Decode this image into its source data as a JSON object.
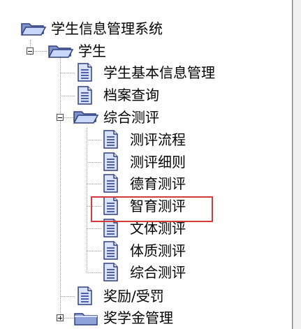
{
  "tree": {
    "root": {
      "label": "学生信息管理系统",
      "icon": "folder-open-icon"
    },
    "student": {
      "label": "学生",
      "icon": "folder-open-icon",
      "children": [
        {
          "label": "学生基本信息管理",
          "icon": "document-icon"
        },
        {
          "label": "档案查询",
          "icon": "document-icon"
        },
        {
          "label": "综合测评",
          "icon": "folder-open-icon",
          "children": [
            {
              "label": "测评流程",
              "icon": "document-icon"
            },
            {
              "label": "测评细则",
              "icon": "document-icon"
            },
            {
              "label": "德育测评",
              "icon": "document-icon"
            },
            {
              "label": "智育测评",
              "icon": "document-icon"
            },
            {
              "label": "文体测评",
              "icon": "document-icon"
            },
            {
              "label": "体质测评",
              "icon": "document-icon"
            },
            {
              "label": "综合测评",
              "icon": "document-icon"
            }
          ]
        },
        {
          "label": "奖励/受罚",
          "icon": "document-icon"
        },
        {
          "label": "奖学金管理",
          "icon": "folder-icon"
        }
      ]
    }
  },
  "colors": {
    "highlight": "#d33a3a"
  }
}
